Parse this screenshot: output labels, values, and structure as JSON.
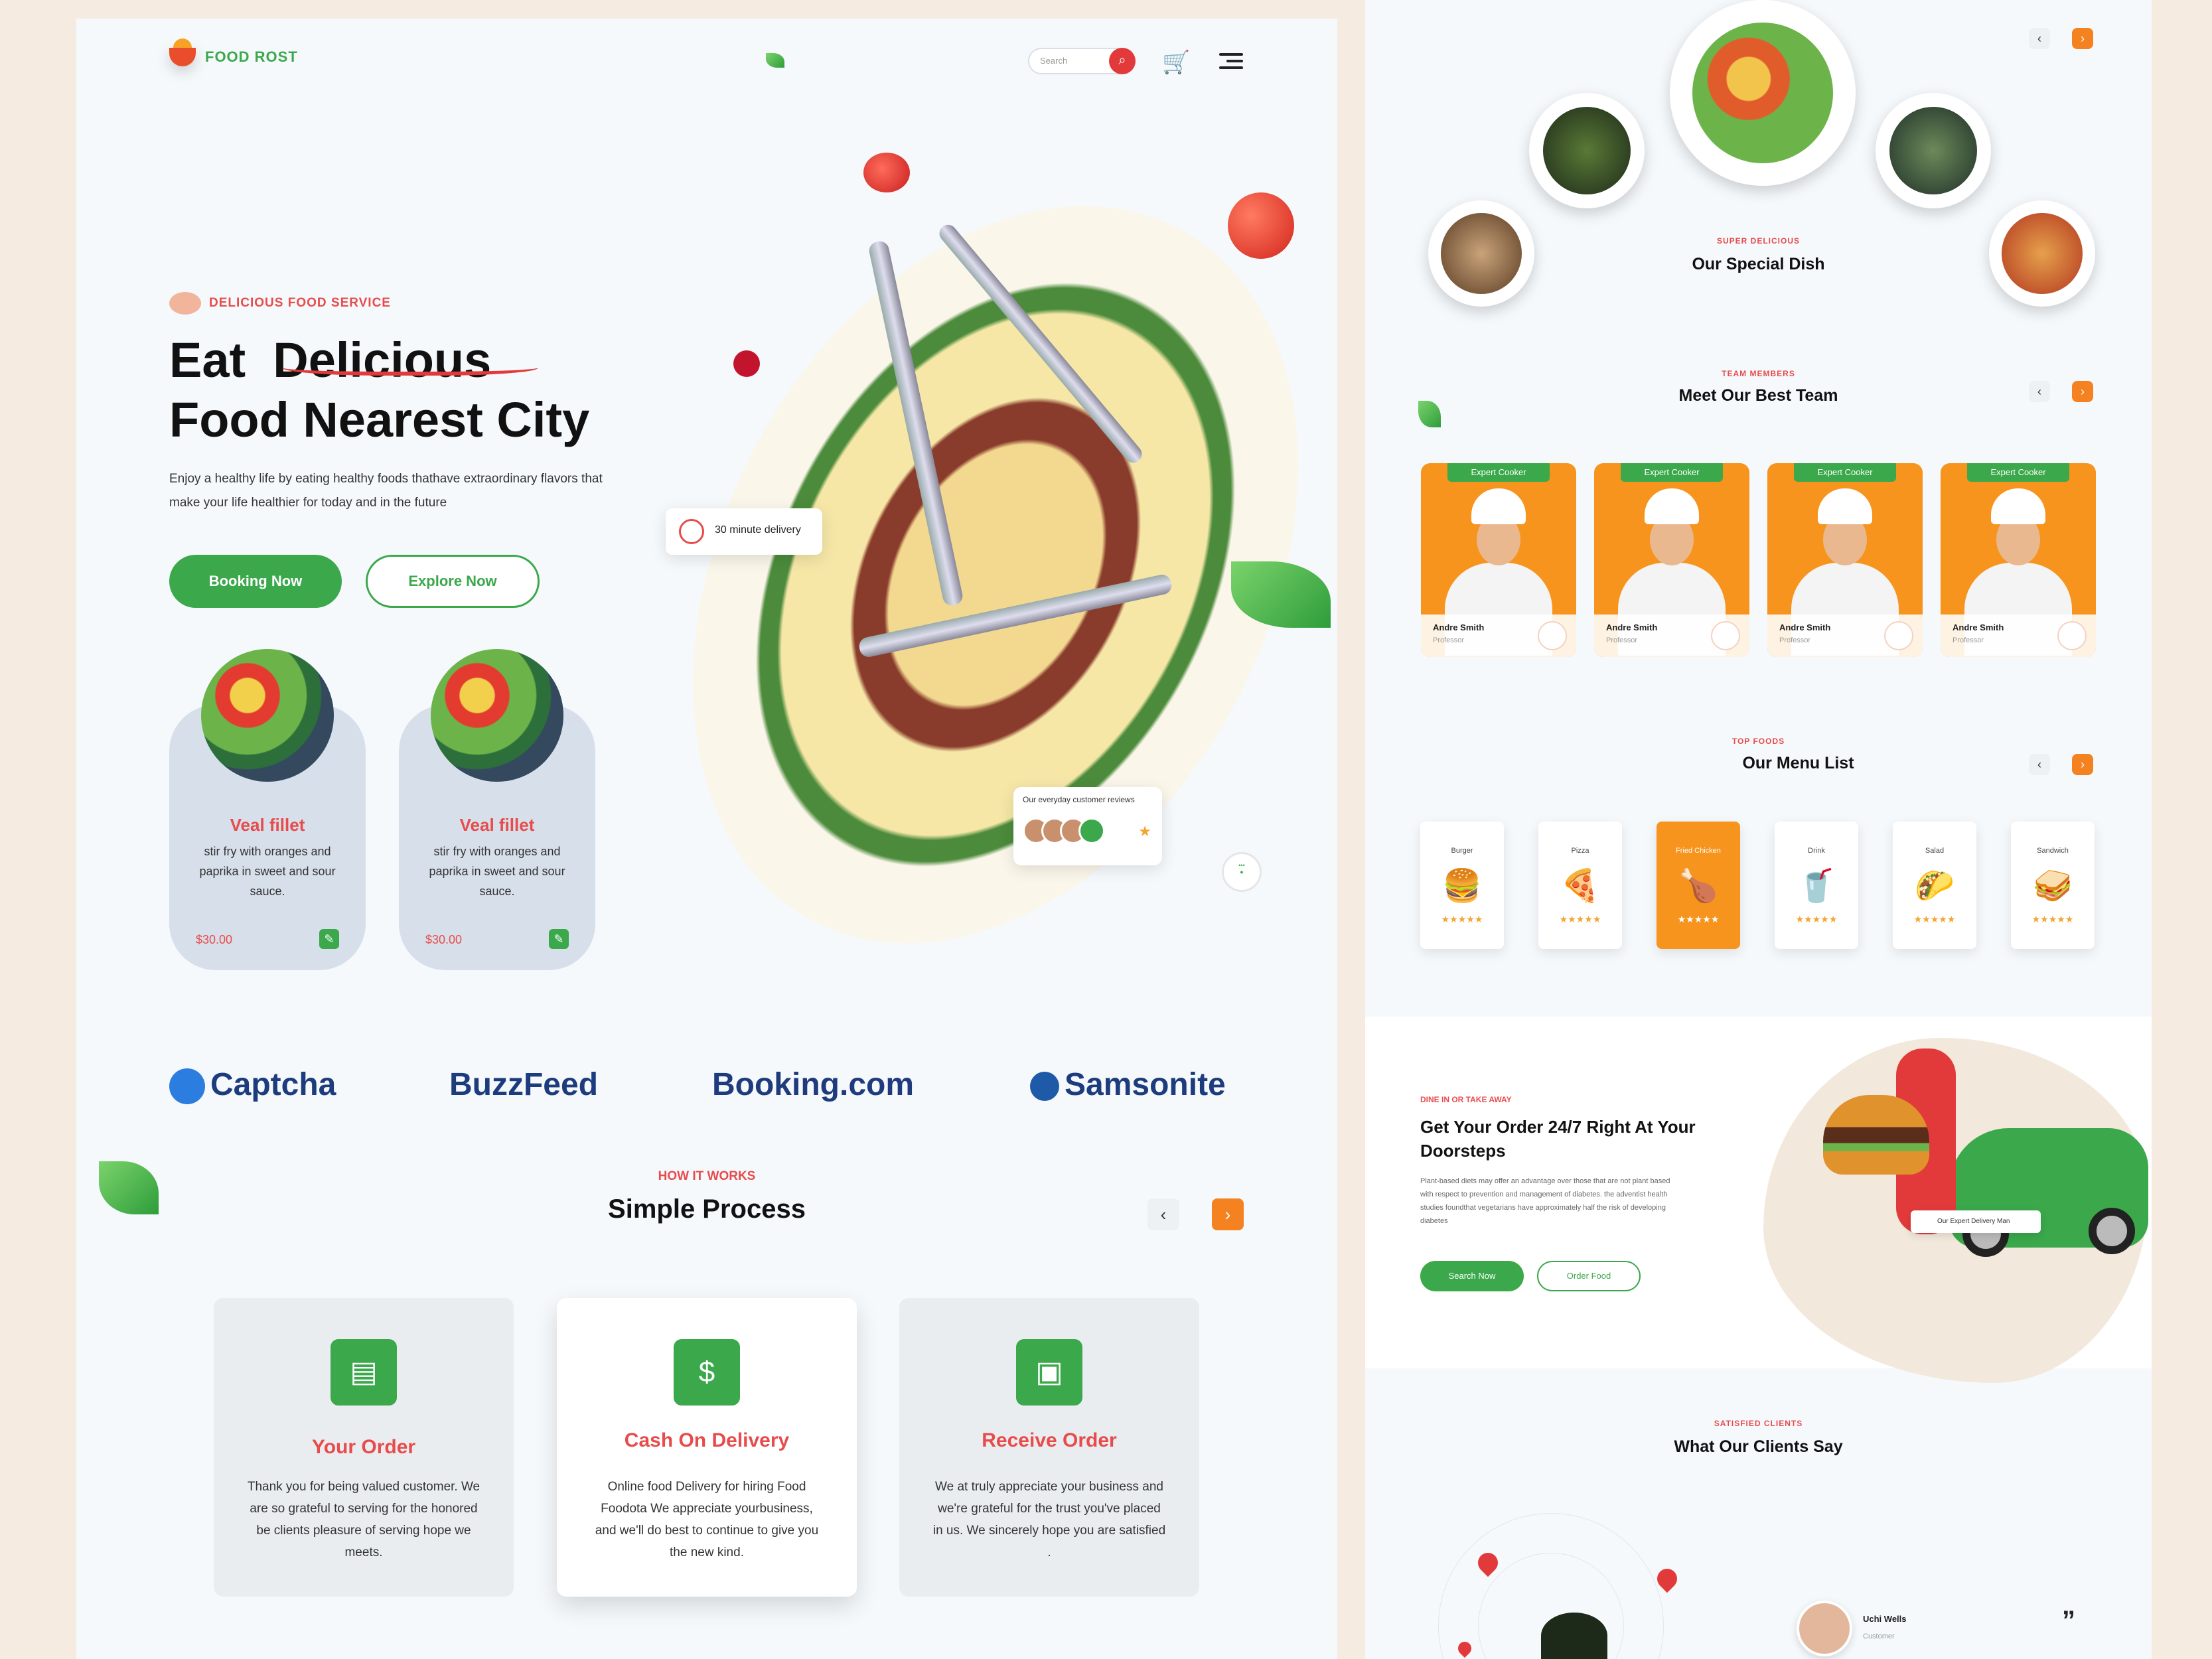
{
  "brand": {
    "name": "FOOD ROST"
  },
  "header": {
    "search_placeholder": "Search",
    "cart_icon": "cart-icon",
    "menu_icon": "hamburger-menu-icon"
  },
  "hero": {
    "eyebrow": "DELICIOUS FOOD SERVICE",
    "title_line1": "Eat  Delicious",
    "title_line2": "Food Nearest City",
    "subtitle": "Enjoy a healthy life by eating healthy foods thathave extraordinary flavors that make your life healthier for today and in the future",
    "primary_button": "Booking Now",
    "secondary_button": "Explore Now",
    "delivery_tag": "30 minute delivery",
    "review_tag": "Our everyday customer reviews",
    "dishes": [
      {
        "name": "Veal fillet",
        "desc": "stir fry with oranges and paprika in sweet and sour sauce.",
        "price": "$30.00"
      },
      {
        "name": "Veal fillet",
        "desc": "stir fry with oranges and paprika in sweet and sour sauce.",
        "price": "$30.00"
      }
    ]
  },
  "partners": [
    "Captcha",
    "BuzzFeed",
    "Booking.com",
    "Samsonite"
  ],
  "how_it_works": {
    "eyebrow": "HOW IT WORKS",
    "title": "Simple Process",
    "steps": [
      {
        "title": "Your Order",
        "desc": "Thank you for being valued customer. We are so grateful to serving for the honored be clients pleasure of serving hope we meets."
      },
      {
        "title": "Cash On Delivery",
        "desc": "Online food Delivery for hiring Food Foodota We appreciate yourbusiness, and we'll do best to continue to give you the new kind."
      },
      {
        "title": "Receive Order",
        "desc": "We at truly appreciate your business and we're grateful for the trust you've placed in us. We sincerely hope you are satisfied ."
      }
    ]
  },
  "special": {
    "eyebrow": "SUPER DELICIOUS",
    "title": "Our Special Dish"
  },
  "team": {
    "eyebrow": "TEAM MEMBERS",
    "title": "Meet Our Best Team",
    "members": [
      {
        "badge": "Expert Cooker",
        "name": "Andre Smith",
        "role": "Professor"
      },
      {
        "badge": "Expert Cooker",
        "name": "Andre Smith",
        "role": "Professor"
      },
      {
        "badge": "Expert Cooker",
        "name": "Andre Smith",
        "role": "Professor"
      },
      {
        "badge": "Expert Cooker",
        "name": "Andre Smith",
        "role": "Professor"
      }
    ]
  },
  "menu": {
    "eyebrow": "TOP FOODS",
    "title": "Our Menu List",
    "items": [
      {
        "label": "Burger",
        "icon": "🍔",
        "stars": "★★★★★"
      },
      {
        "label": "Pizza",
        "icon": "🍕",
        "stars": "★★★★★"
      },
      {
        "label": "Fried Chicken",
        "icon": "🍗",
        "stars": "★★★★★"
      },
      {
        "label": "Drink",
        "icon": "🥤",
        "stars": "★★★★★"
      },
      {
        "label": "Salad",
        "icon": "🌮",
        "stars": "★★★★★"
      },
      {
        "label": "Sandwich",
        "icon": "🥪",
        "stars": "★★★★★"
      }
    ]
  },
  "order": {
    "eyebrow": "DINE IN OR TAKE AWAY",
    "title": "Get Your Order 24/7 Right At Your Doorsteps",
    "desc": "Plant-based diets may offer an advantage over those that are not plant based with respect to prevention and management of diabetes. the adventist health studies foundthat vegetarians have approximately half the risk of developing diabetes",
    "primary_button": "Search Now",
    "secondary_button": "Order Food",
    "delivery_tag": "Our Expert Delivery Man"
  },
  "testimonials": {
    "eyebrow": "SATISFIED CLIENTS",
    "title": "What Our Clients Say",
    "client_name": "Uchi Wells",
    "client_role": "Customer"
  },
  "colors": {
    "green": "#3aa84b",
    "red": "#e84b4b",
    "orange": "#f7941d",
    "navy": "#1d3c7e"
  }
}
